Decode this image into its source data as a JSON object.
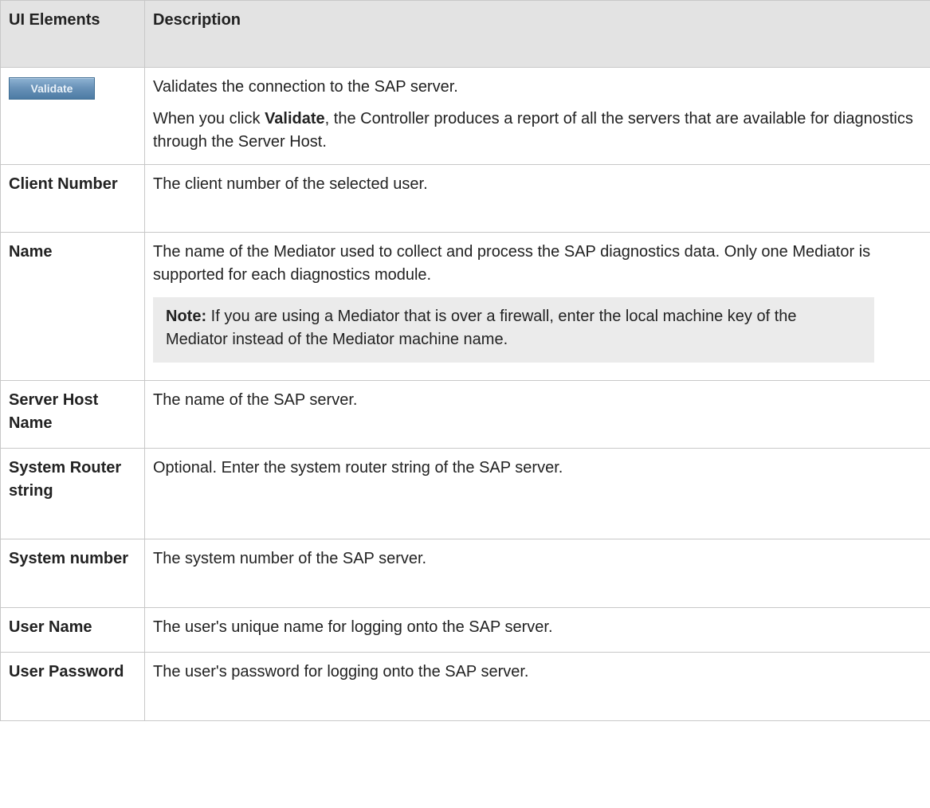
{
  "table": {
    "headers": {
      "elements": "UI Elements",
      "description": "Description"
    },
    "validate": {
      "button_label": "Validate",
      "desc_line1": "Validates the connection to the SAP server.",
      "desc_pre": "When you click ",
      "desc_bold": "Validate",
      "desc_post": ", the Controller produces a report of all the servers that are available for diagnostics through the Server Host."
    },
    "client_number": {
      "label": "Client Number",
      "desc": "The client number of the selected user."
    },
    "name": {
      "label": "Name",
      "desc": "The name of the Mediator used to collect and process the SAP diagnostics data. Only one Mediator is supported for each diagnostics module.",
      "note_label": "Note:",
      "note_text": " If you are using a Mediator that is over a firewall, enter the local machine key of the Mediator instead of the Mediator machine name."
    },
    "server_host_name": {
      "label": "Server Host Name",
      "desc": "The name of the SAP server."
    },
    "system_router_string": {
      "label": "System Router string",
      "desc": "Optional. Enter the system router string of the SAP server."
    },
    "system_number": {
      "label": "System number",
      "desc": "The system number of the SAP server."
    },
    "user_name": {
      "label": "User Name",
      "desc": "The user's unique name for logging onto the SAP server."
    },
    "user_password": {
      "label": "User Password",
      "desc": "The user's password for logging onto the SAP server."
    }
  }
}
